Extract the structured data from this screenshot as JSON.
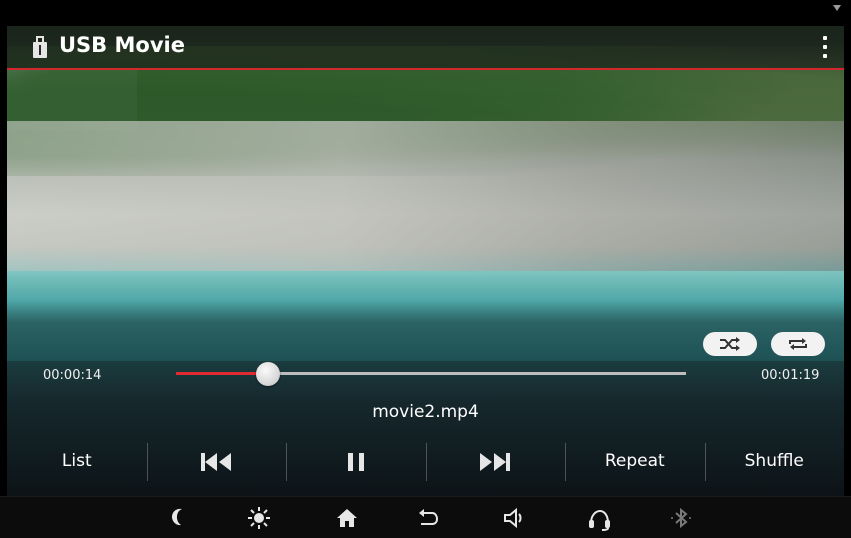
{
  "window": {
    "title": "USB Movie"
  },
  "icons": {
    "usb": "usb-icon",
    "menu": "overflow-menu-icon",
    "shuffle_mode": "shuffle-icon",
    "repeat_mode": "repeat-icon",
    "prev": "skip-previous-icon",
    "pause": "pause-icon",
    "next": "skip-next-icon",
    "night": "moon-icon",
    "brightness": "brightness-icon",
    "home": "home-icon",
    "back": "back-icon",
    "volume": "volume-icon",
    "voice": "voice-control-icon",
    "bluetooth": "bluetooth-icon"
  },
  "playback": {
    "elapsed": "00:00:14",
    "total": "00:01:19",
    "progress": 0.18,
    "filename": "movie2.mp4"
  },
  "controls": {
    "list_label": "List",
    "repeat_label": "Repeat",
    "shuffle_label": "Shuffle"
  },
  "colors": {
    "accent_red": "#e02a2f",
    "titlebar_line": "#d3272e",
    "bluetooth_inactive": "#7a7a7a"
  }
}
